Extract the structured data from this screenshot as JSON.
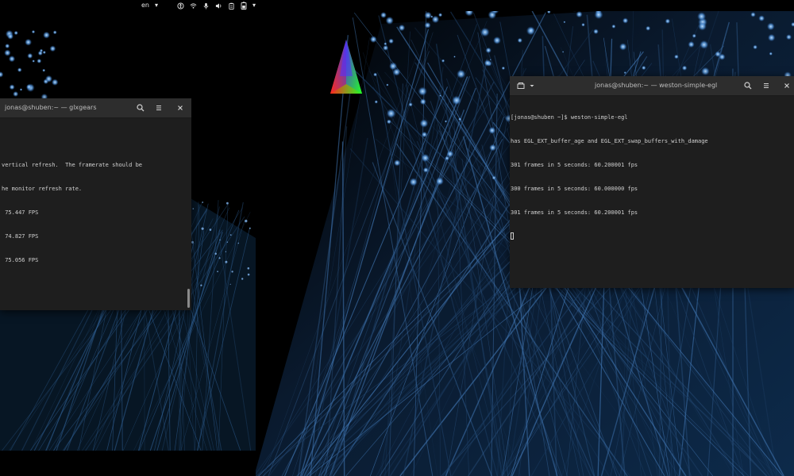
{
  "topbar": {
    "language": "en",
    "language_arrow": "▾",
    "menu_arrow": "▾"
  },
  "window_left": {
    "title": "jonas@shuben:~ — glxgears",
    "lines": [
      "",
      "vertical refresh.  The framerate should be",
      "he monitor refresh rate.",
      " 75.447 FPS",
      " 74.827 FPS",
      " 75.056 FPS"
    ]
  },
  "window_right": {
    "title": "jonas@shuben:~ — weston-simple-egl",
    "lines": [
      "[jonas@shuben ~]$ weston-simple-egl",
      "has EGL_EXT_buffer_age and EGL_EXT_swap_buffers_with_damage",
      "301 frames in 5 seconds: 60.200001 fps",
      "300 frames in 5 seconds: 60.000000 fps",
      "301 frames in 5 seconds: 60.200001 fps"
    ]
  },
  "colors": {
    "terminal_bg": "#1e1e1e",
    "header_bg": "#2d2d2d",
    "text": "#cfcfcf",
    "wallpaper_accent": "#5a9be0"
  },
  "icons": {
    "topbar": [
      "accessibility-icon",
      "network-wifi-icon",
      "microphone-icon",
      "volume-icon",
      "clipboard-icon",
      "battery-icon",
      "system-menu-arrow-icon"
    ],
    "terminal_header": [
      "new-tab-icon",
      "search-icon",
      "menu-icon",
      "close-icon"
    ]
  }
}
